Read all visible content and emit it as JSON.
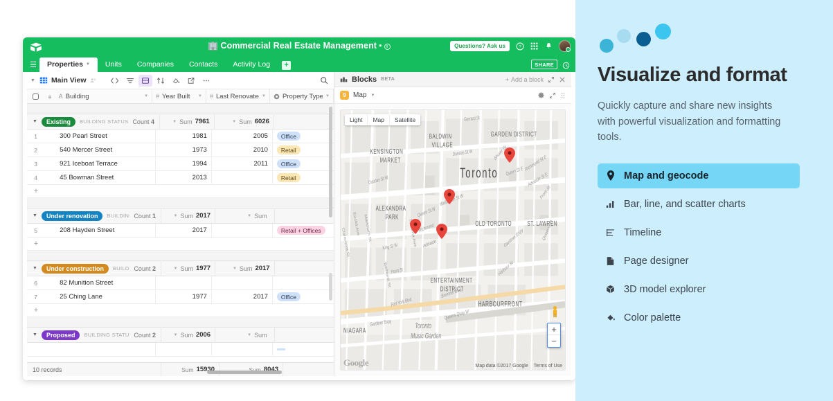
{
  "app": {
    "logo": "airtable-logo-icon",
    "title": "Commercial Real Estate Management",
    "title_emoji": "🏢",
    "title_sep": "•",
    "ask_pill": "Questions? Ask us",
    "icons": [
      "help-icon",
      "apps-grid-icon",
      "bell-icon",
      "avatar"
    ],
    "tabs": [
      {
        "label": "Properties",
        "active": true
      },
      {
        "label": "Units",
        "active": false
      },
      {
        "label": "Companies",
        "active": false
      },
      {
        "label": "Contacts",
        "active": false
      },
      {
        "label": "Activity Log",
        "active": false
      }
    ],
    "add_tab_label": "+",
    "share_label": "SHARE",
    "history_icon": "history-icon"
  },
  "view_bar": {
    "view_name": "Main View",
    "tools": [
      "hide-fields-icon",
      "filter-icon",
      "group-icon",
      "sort-icon",
      "color-icon",
      "share-view-icon",
      "more-icon"
    ],
    "search_icon": "search-icon"
  },
  "grid": {
    "columns": [
      {
        "label": "Building",
        "type_icon": "text-icon"
      },
      {
        "label": "Year Built",
        "type_icon": "number-icon"
      },
      {
        "label": "Last Renovated",
        "type_icon": "number-icon"
      },
      {
        "label": "Property Type",
        "type_icon": "single-select-icon"
      }
    ],
    "group_field_label": "BUILDING STATUS",
    "groups": [
      {
        "name": "Existing",
        "color": "#1a8a3c",
        "field_label": "BUILDING STATUS",
        "count_label": "Count",
        "count": "4",
        "sum_year_label": "Sum",
        "sum_year": "7961",
        "sum_reno_label": "Sum",
        "sum_reno": "6026",
        "rows": [
          {
            "num": "1",
            "building": "300 Pearl Street",
            "year": "1981",
            "renovated": "2005",
            "type": "Office",
            "type_bg": "#cfe0f9",
            "type_fg": "#2b3d57"
          },
          {
            "num": "2",
            "building": "540 Mercer Street",
            "year": "1973",
            "renovated": "2010",
            "type": "Retail",
            "type_bg": "#fbe6b4",
            "type_fg": "#5a4514"
          },
          {
            "num": "3",
            "building": "921 Iceboat Terrace",
            "year": "1994",
            "renovated": "2011",
            "type": "Office",
            "type_bg": "#cfe0f9",
            "type_fg": "#2b3d57"
          },
          {
            "num": "4",
            "building": "45 Bowman Street",
            "year": "2013",
            "renovated": "",
            "type": "Retail",
            "type_bg": "#fbe6b4",
            "type_fg": "#5a4514"
          }
        ]
      },
      {
        "name": "Under renovation",
        "color": "#1283c3",
        "field_label": "BUILDING ST",
        "count_label": "Count",
        "count": "1",
        "sum_year_label": "Sum",
        "sum_year": "2017",
        "sum_reno_label": "Sum",
        "sum_reno": "",
        "rows": [
          {
            "num": "5",
            "building": "208 Hayden Street",
            "year": "2017",
            "renovated": "",
            "type": "Retail + Offices",
            "type_bg": "#fbd3e3",
            "type_fg": "#6e2847"
          }
        ]
      },
      {
        "name": "Under construction",
        "color": "#d2891d",
        "field_label": "BUILDING",
        "count_label": "Count",
        "count": "2",
        "sum_year_label": "Sum",
        "sum_year": "1977",
        "sum_reno_label": "Sum",
        "sum_reno": "2017",
        "rows": [
          {
            "num": "6",
            "building": "82 Munition Street",
            "year": "",
            "renovated": "",
            "type": "",
            "type_bg": "transparent",
            "type_fg": "#333"
          },
          {
            "num": "7",
            "building": "25 Ching Lane",
            "year": "1977",
            "renovated": "2017",
            "type": "Office",
            "type_bg": "#cfe0f9",
            "type_fg": "#2b3d57"
          }
        ]
      },
      {
        "name": "Proposed",
        "color": "#7c38c9",
        "field_label": "BUILDING STATUS",
        "count_label": "Count",
        "count": "2",
        "sum_year_label": "Sum",
        "sum_year": "2006",
        "sum_reno_label": "Sum",
        "sum_reno": "",
        "rows": []
      }
    ],
    "add_row_label": "+",
    "footer": {
      "records": "10 records",
      "sum_year_label": "Sum",
      "sum_year": "15930",
      "sum_reno_label": "Sum",
      "sum_reno": "8043"
    }
  },
  "blocks": {
    "title": "Blocks",
    "beta": "BETA",
    "add_block": "Add a block",
    "expand_icon": "expand-icon",
    "close_icon": "close-icon",
    "block": {
      "badge": "9",
      "name": "Map",
      "settings_icon": "gear-icon",
      "fullscreen_icon": "expand-icon",
      "drag_icon": "drag-handle-icon"
    },
    "map": {
      "toggles": [
        "Light",
        "Map",
        "Satellite"
      ],
      "zoom_in": "+",
      "zoom_out": "−",
      "credit": "Map data ©2017 Google",
      "terms": "Terms of Use",
      "watermark": "Google",
      "labels": [
        "Toronto",
        "GARDEN DISTRICT",
        "BALDWIN VILLAGE",
        "KENSINGTON MARKET",
        "ALEXANDRA PARK",
        "OLD TORONTO",
        "ST. LAWREN",
        "ENTERTAINMENT DISTRICT",
        "HARBOURFRONT",
        "NIAGARA",
        "Toronto Music Garden",
        "Gerrard St",
        "Dundas St W",
        "Shuter St",
        "Queen St E",
        "Richmond St E",
        "Adelaide St E",
        "Front St",
        "Queen St W",
        "Richmond St W",
        "Adelaide St W",
        "Wellington St W",
        "King St W",
        "Front St",
        "Fort York Blvd",
        "Gardiner Expy",
        "Queens Quay W",
        "Bremner Blvd",
        "Harbour St",
        "Spadina Ave",
        "Bathurst St",
        "Euclid Ave",
        "Markham St",
        "Claremont St",
        "Dundas St W",
        "Queens Q"
      ],
      "pin_count": 4
    }
  },
  "promo": {
    "heading": "Visualize and format",
    "body": "Quickly capture and share new insights with powerful visualization and formatting tools.",
    "accent": "#76d6f5",
    "background": "#cdeefc",
    "dots": [
      "#3cb4d8",
      "#a7dcf0",
      "#0b5e91",
      "#3cc5ee"
    ],
    "items": [
      {
        "label": "Map and geocode",
        "icon": "map-pin-icon",
        "active": true
      },
      {
        "label": "Bar, line, and scatter charts",
        "icon": "bar-chart-icon",
        "active": false
      },
      {
        "label": "Timeline",
        "icon": "timeline-icon",
        "active": false
      },
      {
        "label": "Page designer",
        "icon": "page-icon",
        "active": false
      },
      {
        "label": "3D model explorer",
        "icon": "cube-icon",
        "active": false
      },
      {
        "label": "Color palette",
        "icon": "paint-bucket-icon",
        "active": false
      }
    ]
  }
}
